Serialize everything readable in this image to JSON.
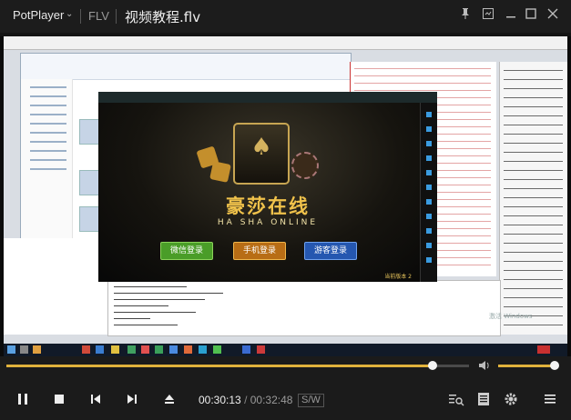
{
  "app": {
    "name": "PotPlayer",
    "format": "FLV",
    "filename": "视频教程.flv"
  },
  "window_controls": [
    "pin-icon",
    "settings-icon",
    "minimize-icon",
    "maximize-icon",
    "fullscreen-icon",
    "close-icon"
  ],
  "video": {
    "game": {
      "title_cn": "豪莎在线",
      "title_en": "HA SHA ONLINE",
      "buttons": [
        "微信登录",
        "手机登录",
        "游客登录"
      ],
      "version": "当前版本 2"
    },
    "watermark": "激活 Windows"
  },
  "playback": {
    "current_time": "00:30:13",
    "separator": "/",
    "total_time": "00:32:48",
    "mode": "S/W",
    "progress_fraction": 0.921,
    "volume_fraction": 1.0
  },
  "controls": [
    "pause-icon",
    "stop-icon",
    "previous-icon",
    "next-icon",
    "eject-icon",
    "playlist-search-icon",
    "info-icon",
    "settings-gear-icon",
    "menu-icon"
  ],
  "colors": {
    "accent": "#e1b23c",
    "background": "#1b1b1b"
  }
}
